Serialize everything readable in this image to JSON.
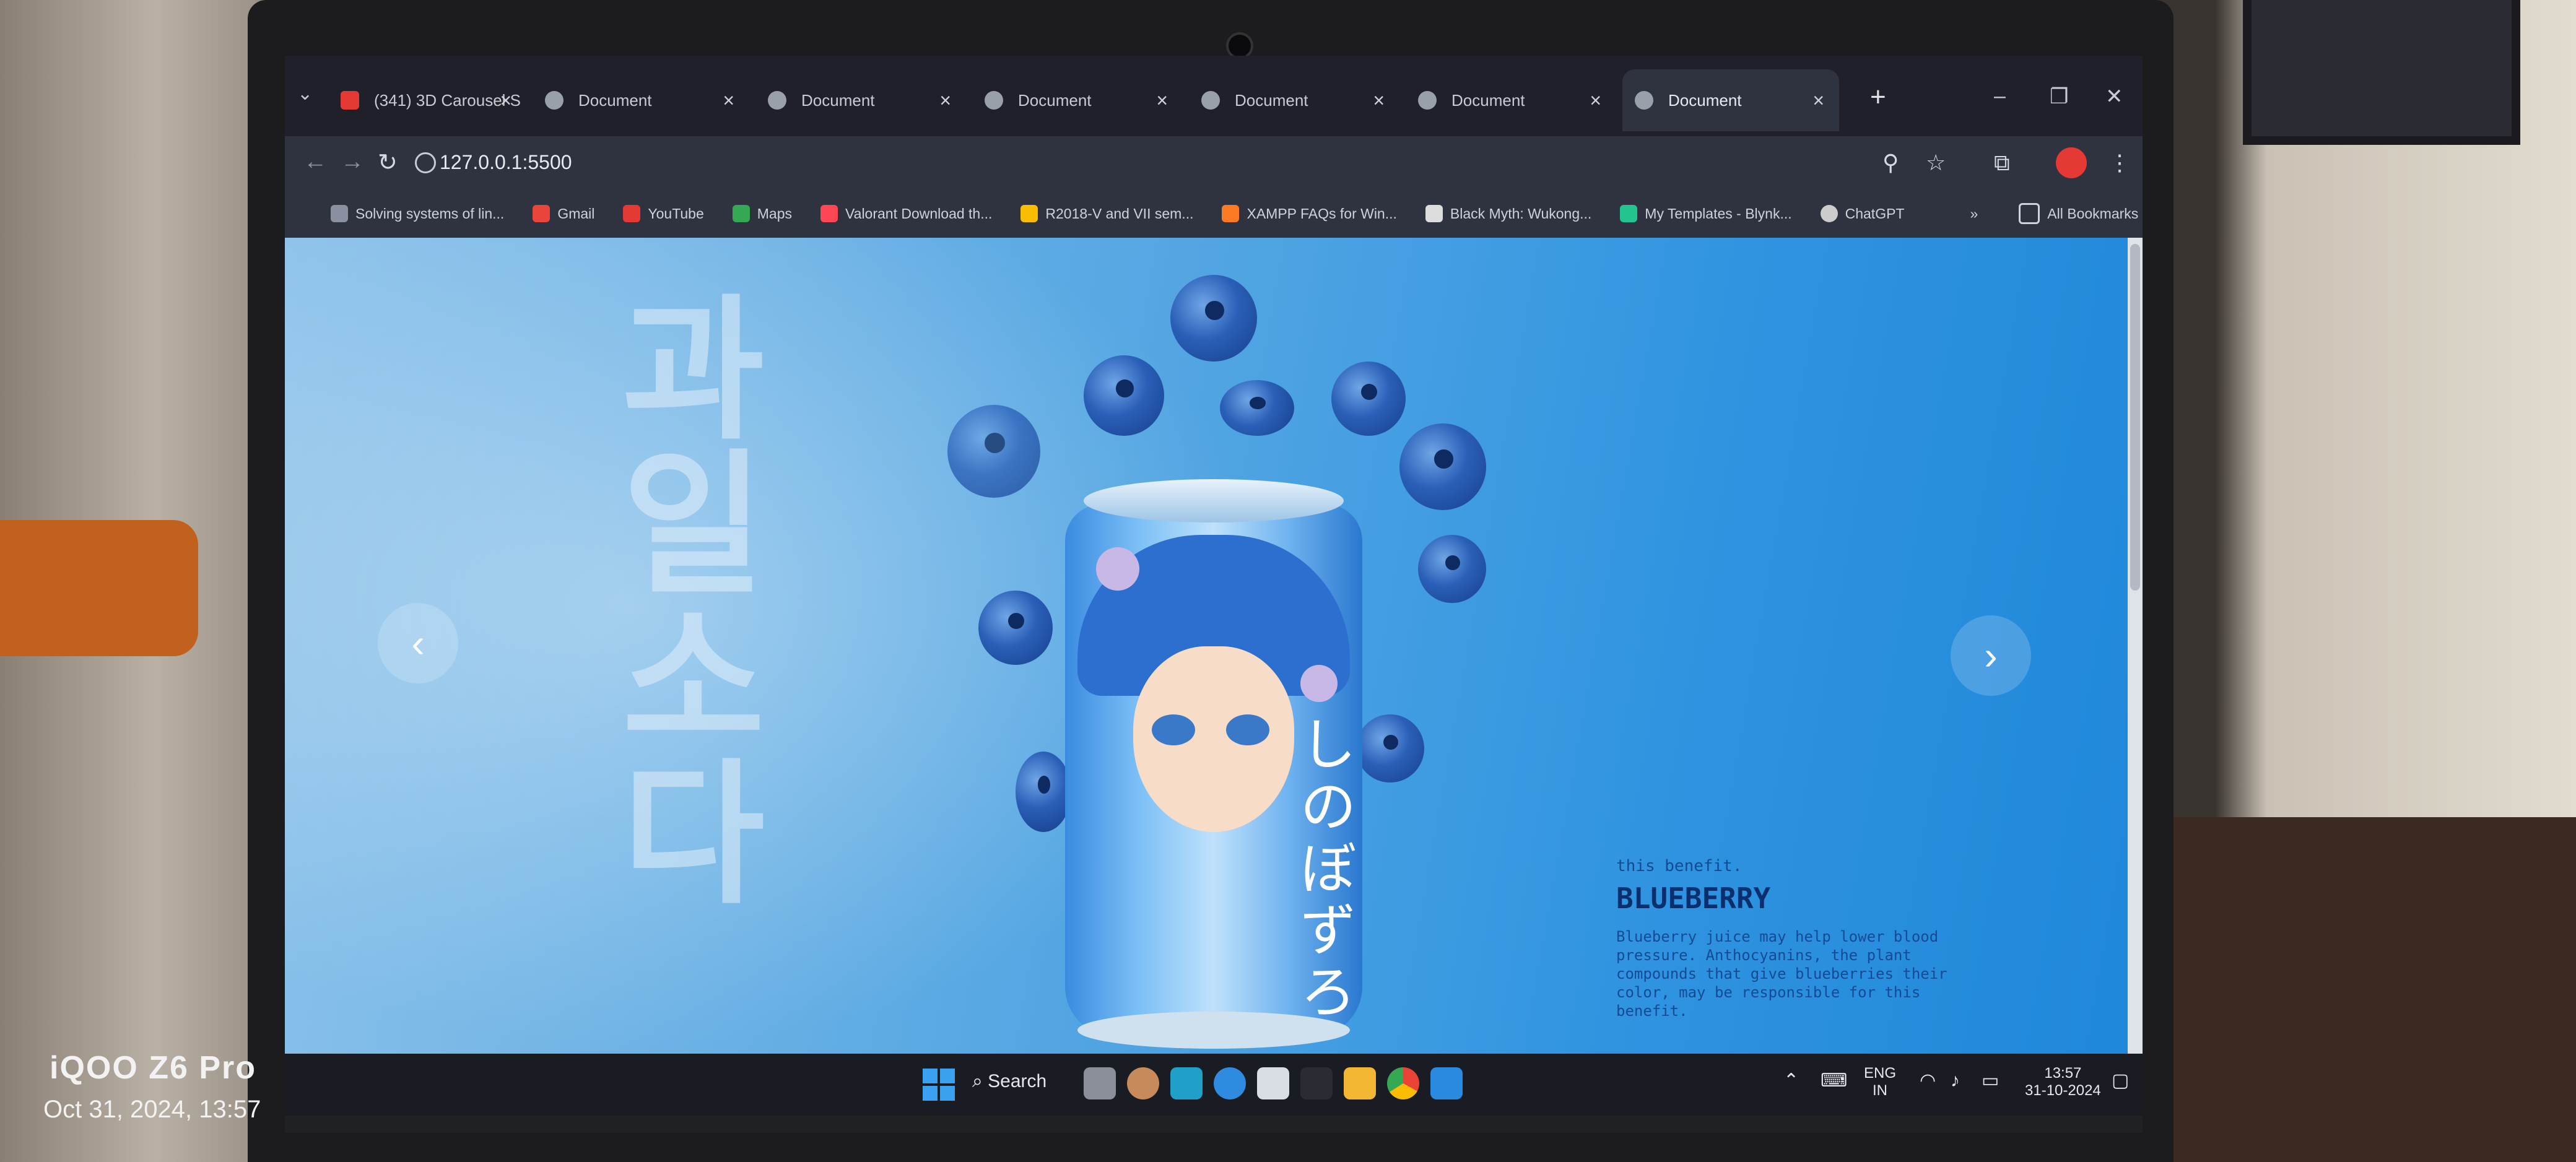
{
  "photo": {
    "brand": "iQOO Z6 Pro",
    "datetime": "Oct 31, 2024, 13:57"
  },
  "browser": {
    "tabs": [
      {
        "title": "(341) 3D Carousel S",
        "icon": "youtube-icon",
        "active": false
      },
      {
        "title": "Document",
        "icon": "globe-icon",
        "active": false
      },
      {
        "title": "Document",
        "icon": "globe-icon",
        "active": false
      },
      {
        "title": "Document",
        "icon": "globe-icon",
        "active": false
      },
      {
        "title": "Document",
        "icon": "globe-icon",
        "active": false
      },
      {
        "title": "Document",
        "icon": "globe-icon",
        "active": false
      },
      {
        "title": "Document",
        "icon": "globe-icon",
        "active": true
      }
    ],
    "close_glyph": "×",
    "new_tab_glyph": "+",
    "window_controls": {
      "minimize": "–",
      "restore": "❐",
      "close": "✕"
    },
    "nav": {
      "back": "←",
      "forward": "→",
      "reload": "↻"
    },
    "url": "127.0.0.1:5500",
    "toolbar_icons": {
      "zoom": "⚲",
      "star": "☆",
      "extensions": "⧉",
      "menu": "⋮"
    },
    "bookmarks": [
      {
        "label": "Solving systems of lin...",
        "icon": "khan-icon"
      },
      {
        "label": "Gmail",
        "icon": "gmail-icon"
      },
      {
        "label": "YouTube",
        "icon": "youtube-icon"
      },
      {
        "label": "Maps",
        "icon": "maps-icon"
      },
      {
        "label": "Valorant Download th...",
        "icon": "valorant-icon"
      },
      {
        "label": "R2018-V and VII sem...",
        "icon": "drive-icon"
      },
      {
        "label": "XAMPP FAQs for Win...",
        "icon": "xampp-icon"
      },
      {
        "label": "Black Myth: Wukong...",
        "icon": "wukong-icon"
      },
      {
        "label": "My Templates - Blynk...",
        "icon": "blynk-icon"
      },
      {
        "label": "ChatGPT",
        "icon": "chatgpt-icon"
      }
    ],
    "bookmarks_more": "»",
    "all_bookmarks": "All Bookmarks"
  },
  "page": {
    "vertical_text": [
      "과",
      "일",
      "소",
      "다"
    ],
    "prev_arrow": "‹",
    "next_arrow": "›",
    "can_text": "しのぼずろ",
    "info": {
      "overline": "this benefit.",
      "title": "BLUEBERRY",
      "description": "Blueberry juice may help lower blood pressure. Anthocyanins, the plant compounds that give blueberries their color, may be responsible for this benefit."
    },
    "colors": {
      "background": "#2e93e0",
      "title": "#0a2f6e"
    }
  },
  "taskbar": {
    "search": "Search",
    "language": "ENG",
    "region": "IN",
    "time": "13:57",
    "date": "31-10-2024"
  }
}
